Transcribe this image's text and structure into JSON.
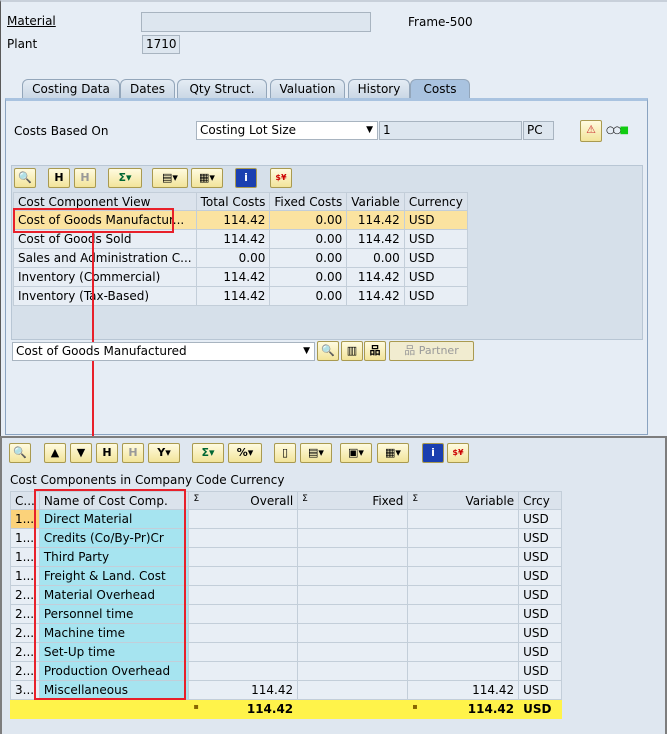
{
  "header": {
    "material_label": "Material",
    "material_desc": "Frame-500",
    "plant_label": "Plant",
    "plant_value": "1710"
  },
  "tabs": [
    "Costing Data",
    "Dates",
    "Qty Struct.",
    "Valuation",
    "History",
    "Costs"
  ],
  "costs_based_on": {
    "label": "Costs Based On",
    "value": "Costing Lot Size",
    "quantity": "1",
    "unit": "PC"
  },
  "top_table": {
    "headers": [
      "Cost Component View",
      "Total Costs",
      "Fixed Costs",
      "Variable",
      "Currency"
    ],
    "rows": [
      [
        "Cost of Goods Manufactur...",
        "114.42",
        "0.00",
        "114.42",
        "USD"
      ],
      [
        "Cost of Goods Sold",
        "114.42",
        "0.00",
        "114.42",
        "USD"
      ],
      [
        "Sales and Administration C...",
        "0.00",
        "0.00",
        "0.00",
        "USD"
      ],
      [
        "Inventory (Commercial)",
        "114.42",
        "0.00",
        "114.42",
        "USD"
      ],
      [
        "Inventory (Tax-Based)",
        "114.42",
        "0.00",
        "114.42",
        "USD"
      ]
    ]
  },
  "view_select": {
    "value": "Cost of Goods Manufactured",
    "partner_label": "Partner"
  },
  "bottom": {
    "title": "Cost Components in Company Code Currency",
    "headers": [
      "C...",
      "Name of Cost Comp.",
      "Overall",
      "Fixed",
      "Variable",
      "Crcy"
    ],
    "sigma": "Σ",
    "rows": [
      [
        "1...",
        "Direct Material",
        "",
        "",
        "",
        "USD"
      ],
      [
        "1...",
        "Credits (Co/By-Pr)Cr",
        "",
        "",
        "",
        "USD"
      ],
      [
        "1...",
        "Third Party",
        "",
        "",
        "",
        "USD"
      ],
      [
        "1...",
        "Freight & Land. Cost",
        "",
        "",
        "",
        "USD"
      ],
      [
        "2...",
        "Material Overhead",
        "",
        "",
        "",
        "USD"
      ],
      [
        "2...",
        "Personnel time",
        "",
        "",
        "",
        "USD"
      ],
      [
        "2...",
        "Machine time",
        "",
        "",
        "",
        "USD"
      ],
      [
        "2...",
        "Set-Up time",
        "",
        "",
        "",
        "USD"
      ],
      [
        "2...",
        "Production Overhead",
        "",
        "",
        "",
        "USD"
      ],
      [
        "3...",
        "Miscellaneous",
        "114.42",
        "",
        "114.42",
        "USD"
      ]
    ],
    "total": {
      "overall": "114.42",
      "variable": "114.42",
      "currency": "USD",
      "marker": "▪"
    }
  }
}
